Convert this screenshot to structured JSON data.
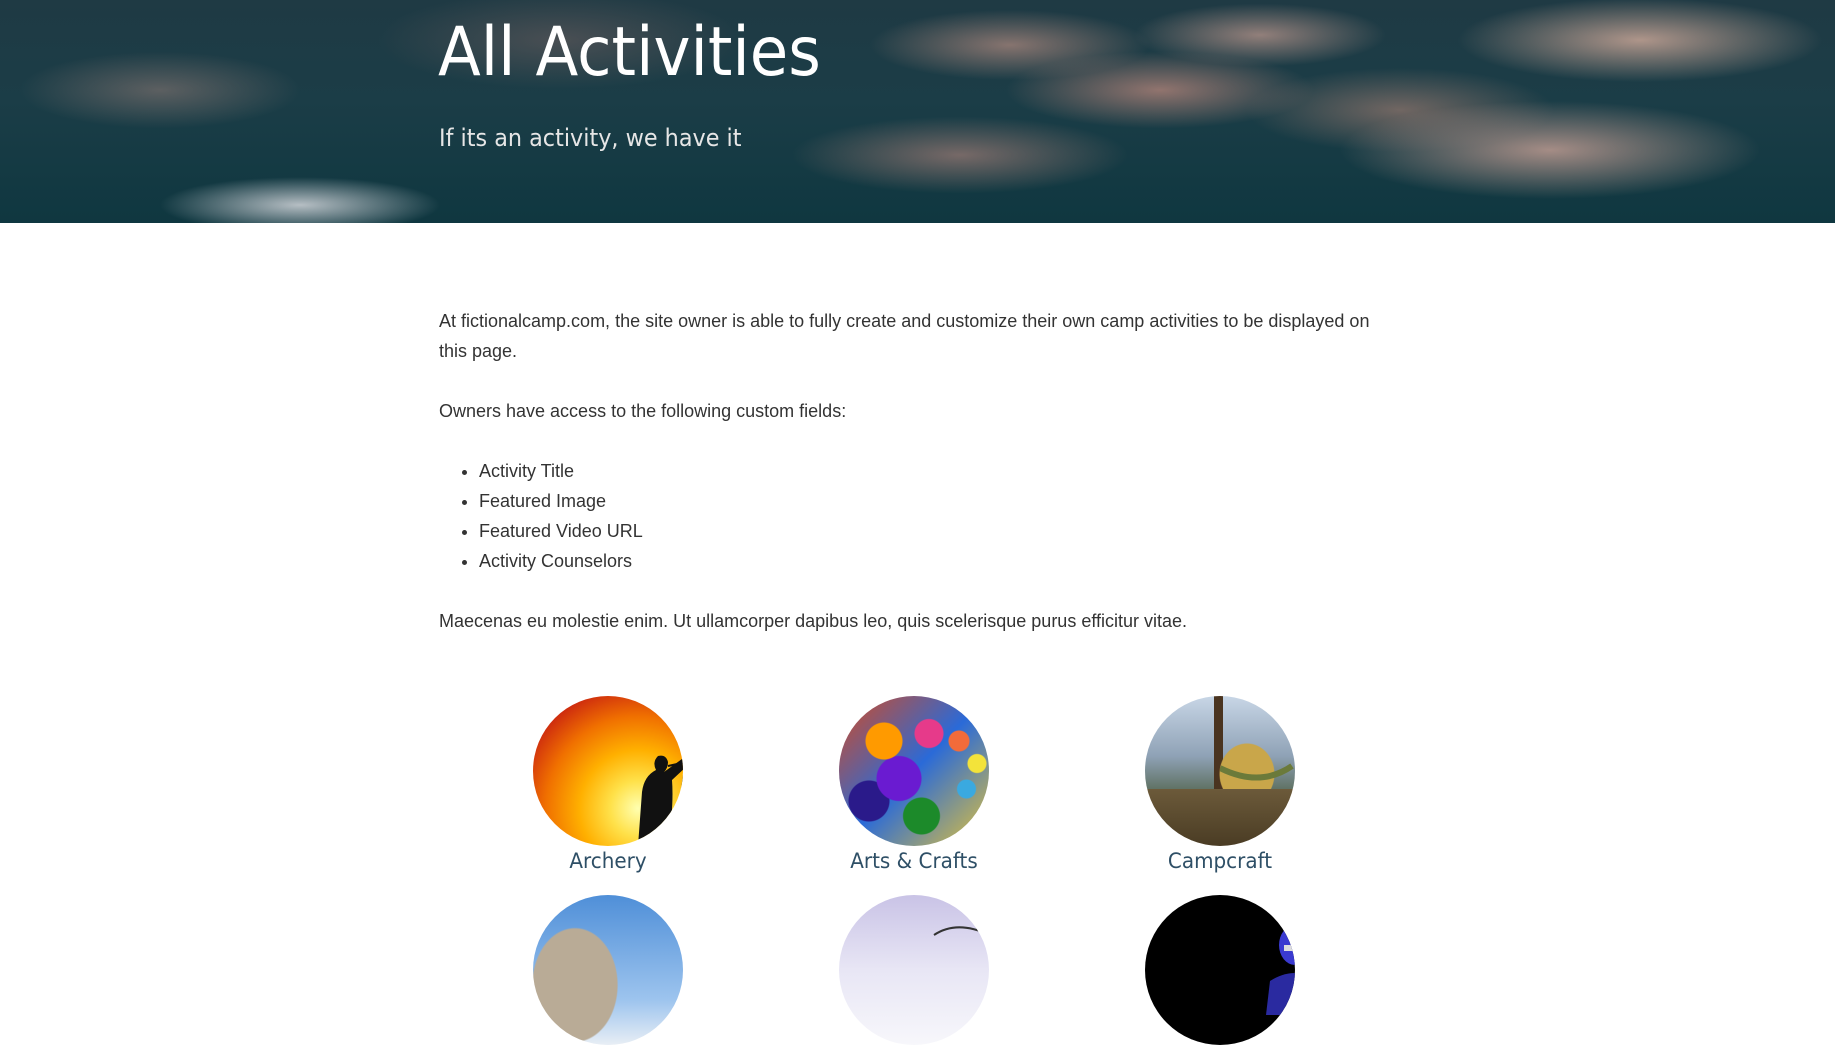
{
  "hero": {
    "title": "All Activities",
    "subtitle": "If its an activity, we have it"
  },
  "intro": {
    "paragraph1": "At fictionalcamp.com, the site owner is able to fully create and customize their own camp activities to be displayed on this page.",
    "paragraph2": "Owners have access to the following custom fields:",
    "fields": [
      "Activity Title",
      "Featured Image",
      "Featured Video URL",
      "Activity Counselors"
    ],
    "paragraph3": "Maecenas eu molestie enim. Ut ullamcorper dapibus leo, quis scelerisque purus efficitur vitae."
  },
  "activities": [
    {
      "title": "Archery",
      "image_icon": "archer-silhouette-image"
    },
    {
      "title": "Arts & Crafts",
      "image_icon": "paint-palette-image"
    },
    {
      "title": "Campcraft",
      "image_icon": "tent-hammock-image"
    },
    {
      "title": "",
      "image_icon": "rock-climbing-image"
    },
    {
      "title": "",
      "image_icon": "fishing-image"
    },
    {
      "title": "",
      "image_icon": "sports-helmet-image"
    }
  ],
  "colors": {
    "activity_title": "#2e4f66",
    "body_text": "#333333"
  }
}
